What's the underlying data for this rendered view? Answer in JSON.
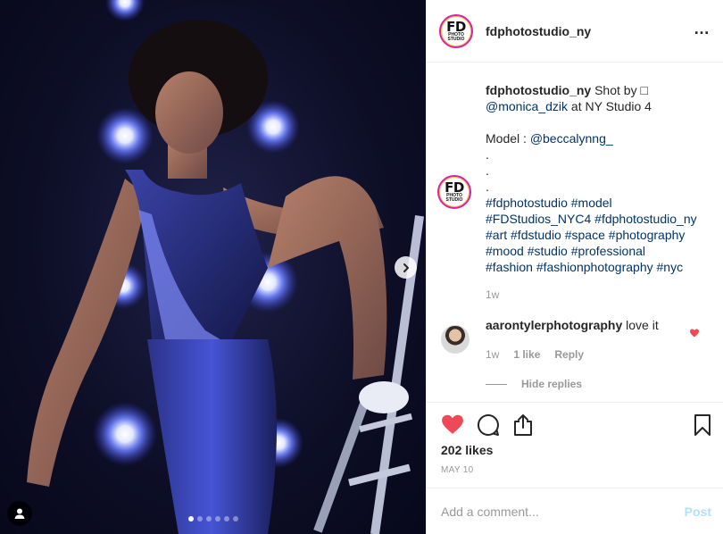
{
  "post": {
    "username": "fdphotostudio_ny",
    "logo_text": {
      "main": "FD",
      "line1": "PHOTO",
      "line2": "STUDIO"
    },
    "more_icon": "…"
  },
  "caption": {
    "username": "fdphotostudio_ny",
    "text1": " Shot by □",
    "mention1": "@monica_dzik",
    "text2": " at NY Studio 4",
    "model_label": "Model : ",
    "mention2": "@beccalynng_",
    "dots": [
      ".",
      ".",
      "."
    ],
    "hashtags": [
      "#fdphotostudio",
      "#model",
      "#FDStudios_NYC4",
      "#fdphotostudio_ny",
      "#art",
      "#fdstudio",
      "#space",
      "#photography",
      "#mood",
      "#studio",
      "#professional",
      "#fashion",
      "#fashionphotography",
      "#nyc"
    ],
    "time": "1w"
  },
  "comment": {
    "username": "aarontylerphotography",
    "text": " love it",
    "time": "1w",
    "likes": "1 like",
    "reply": "Reply",
    "hide_replies": "Hide replies"
  },
  "footer": {
    "likes": "202 likes",
    "date": "MAY 10",
    "comment_placeholder": "Add a comment...",
    "post_label": "Post"
  },
  "carousel": {
    "count": 6,
    "active_index": 0
  },
  "colors": {
    "heart": "#ed4956",
    "link": "#003569",
    "post_disabled": "#b2dffc"
  }
}
